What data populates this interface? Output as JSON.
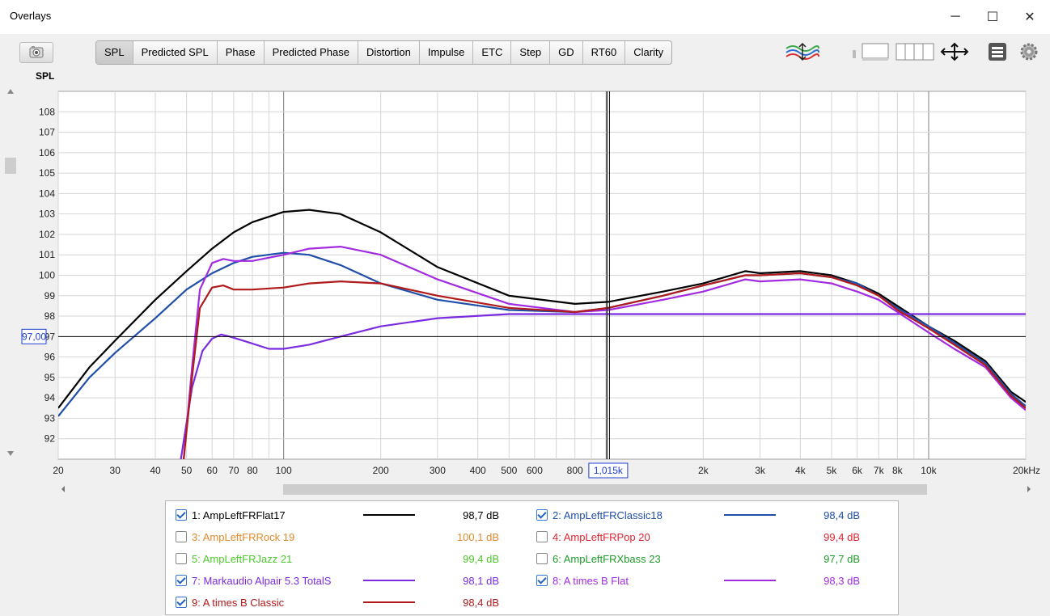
{
  "window": {
    "title": "Overlays"
  },
  "controls": {
    "minimize": "─",
    "maximize": "☐",
    "close": "✕"
  },
  "toolbar": {
    "tabs": [
      {
        "label": "SPL",
        "active": true
      },
      {
        "label": "Predicted SPL"
      },
      {
        "label": "Phase"
      },
      {
        "label": "Predicted Phase"
      },
      {
        "label": "Distortion"
      },
      {
        "label": "Impulse"
      },
      {
        "label": "ETC"
      },
      {
        "label": "Step"
      },
      {
        "label": "GD"
      },
      {
        "label": "RT60"
      },
      {
        "label": "Clarity"
      }
    ],
    "icons": [
      "camera-icon",
      "trace-arrange-icon",
      "panel-layout-icon",
      "column-layout-icon",
      "move-arrows-icon",
      "list-icon",
      "gear-icon"
    ]
  },
  "plot": {
    "y_axis_label": "SPL",
    "cursor_y_readout": "97,00",
    "cursor_x_readout": "1,015k"
  },
  "chart_data": {
    "type": "line",
    "x_scale": "log",
    "xlim": [
      20,
      20000
    ],
    "ylim": [
      91,
      109
    ],
    "y_ticks": [
      "92",
      "93",
      "94",
      "95",
      "96",
      "97",
      "98",
      "99",
      "100",
      "101",
      "102",
      "103",
      "104",
      "105",
      "106",
      "107",
      "108"
    ],
    "x_ticks": [
      "20",
      "30",
      "40",
      "50",
      "60",
      "70",
      "80",
      "100",
      "200",
      "300",
      "400",
      "500",
      "600",
      "800",
      "2k",
      "3k",
      "4k",
      "5k",
      "6k",
      "7k",
      "8k",
      "10k",
      "20kHz"
    ],
    "cursor": {
      "x": 1015,
      "y": 97.0
    },
    "grid": true,
    "series": [
      {
        "name": "1: AmpLeftFRFlat17",
        "color": "#000000",
        "x": [
          20,
          25,
          30,
          40,
          50,
          60,
          70,
          80,
          100,
          120,
          150,
          200,
          300,
          500,
          800,
          1015,
          1500,
          2000,
          2700,
          3000,
          4000,
          5000,
          6000,
          7000,
          8000,
          10000,
          12000,
          15000,
          18000,
          20000
        ],
        "y": [
          93.5,
          95.5,
          96.8,
          98.8,
          100.2,
          101.3,
          102.1,
          102.6,
          103.1,
          103.2,
          103.0,
          102.1,
          100.4,
          99.0,
          98.6,
          98.7,
          99.2,
          99.6,
          100.2,
          100.1,
          100.2,
          100.0,
          99.6,
          99.1,
          98.5,
          97.5,
          96.8,
          95.8,
          94.3,
          93.8
        ]
      },
      {
        "name": "2: AmpLeftFRClassic18",
        "color": "#1f4fa8",
        "x": [
          20,
          25,
          30,
          40,
          50,
          60,
          70,
          80,
          100,
          120,
          150,
          200,
          300,
          500,
          800,
          1015,
          1500,
          2000,
          2700,
          3000,
          4000,
          5000,
          6000,
          7000,
          8000,
          10000,
          12000,
          15000,
          18000,
          20000
        ],
        "y": [
          93.1,
          95.0,
          96.2,
          97.9,
          99.3,
          100.1,
          100.6,
          100.9,
          101.1,
          101.0,
          100.5,
          99.6,
          98.8,
          98.3,
          98.2,
          98.4,
          99.0,
          99.5,
          100.0,
          100.0,
          100.1,
          99.9,
          99.6,
          99.0,
          98.4,
          97.5,
          96.7,
          95.7,
          94.2,
          93.6
        ]
      },
      {
        "name": "3: AmpLeftFRRock 19",
        "color": "#e08a2c",
        "hidden": true,
        "value": "100,1 dB"
      },
      {
        "name": "4: AmpLeftFRPop 20",
        "color": "#e0242f",
        "hidden": true,
        "value": "99,4 dB"
      },
      {
        "name": "5: AmpLeftFRJazz 21",
        "color": "#4cc92b",
        "hidden": true,
        "value": "99,4 dB"
      },
      {
        "name": "6: AmpLeftFRXbass 23",
        "color": "#1e9b2a",
        "hidden": true,
        "value": "97,7 dB"
      },
      {
        "name": "7: Markaudio Alpair 5.3 TotalS",
        "color": "#7b2be0",
        "x": [
          48,
          52,
          56,
          60,
          64,
          68,
          75,
          90,
          100,
          120,
          150,
          200,
          300,
          500,
          800,
          1015,
          2000,
          5000,
          10000,
          20000
        ],
        "y": [
          91.0,
          94.5,
          96.3,
          96.9,
          97.1,
          97.0,
          96.8,
          96.4,
          96.4,
          96.6,
          97.0,
          97.5,
          97.9,
          98.1,
          98.1,
          98.1,
          98.1,
          98.1,
          98.1,
          98.1
        ]
      },
      {
        "name": "8: A times B Flat",
        "color": "#a22be0",
        "x": [
          49,
          52,
          55,
          60,
          65,
          70,
          80,
          100,
          120,
          150,
          200,
          300,
          500,
          800,
          1015,
          1500,
          2000,
          2700,
          3000,
          4000,
          5000,
          6000,
          7000,
          8000,
          10000,
          12000,
          15000,
          18000,
          20000
        ],
        "y": [
          91.0,
          95.5,
          99.3,
          100.6,
          100.8,
          100.7,
          100.7,
          101.0,
          101.3,
          101.4,
          101.0,
          99.8,
          98.6,
          98.2,
          98.3,
          98.8,
          99.2,
          99.8,
          99.7,
          99.8,
          99.6,
          99.2,
          98.8,
          98.2,
          97.2,
          96.4,
          95.5,
          94.0,
          93.4
        ]
      },
      {
        "name": "9: A times B Classic",
        "color": "#b01a1a",
        "x": [
          49,
          52,
          55,
          60,
          65,
          70,
          80,
          100,
          120,
          150,
          200,
          300,
          500,
          800,
          1015,
          1500,
          2000,
          2700,
          3000,
          4000,
          5000,
          6000,
          7000,
          8000,
          10000,
          12000,
          15000,
          18000,
          20000
        ],
        "y": [
          91.0,
          95.0,
          98.4,
          99.4,
          99.5,
          99.3,
          99.3,
          99.4,
          99.6,
          99.7,
          99.6,
          99.0,
          98.4,
          98.2,
          98.4,
          99.0,
          99.5,
          100.0,
          100.0,
          100.1,
          99.9,
          99.5,
          99.0,
          98.3,
          97.4,
          96.6,
          95.6,
          94.1,
          93.5
        ]
      }
    ]
  },
  "legend": {
    "items": [
      {
        "label": "1: AmpLeftFRFlat17",
        "value": "98,7 dB",
        "checked": true,
        "color": "#000000",
        "show_line": true
      },
      {
        "label": "2: AmpLeftFRClassic18",
        "value": "98,4 dB",
        "checked": true,
        "color": "#1f4fa8",
        "show_line": true
      },
      {
        "label": "3: AmpLeftFRRock 19",
        "value": "100,1 dB",
        "checked": false,
        "color": "#e08a2c",
        "show_line": false
      },
      {
        "label": "4: AmpLeftFRPop 20",
        "value": "99,4 dB",
        "checked": false,
        "color": "#e0242f",
        "show_line": false
      },
      {
        "label": "5: AmpLeftFRJazz 21",
        "value": "99,4 dB",
        "checked": false,
        "color": "#4cc92b",
        "show_line": false
      },
      {
        "label": "6: AmpLeftFRXbass 23",
        "value": "97,7 dB",
        "checked": false,
        "color": "#1e9b2a",
        "show_line": false
      },
      {
        "label": "7: Markaudio Alpair 5.3 TotalS",
        "value": "98,1 dB",
        "checked": true,
        "color": "#7b2be0",
        "show_line": true
      },
      {
        "label": "8: A times B Flat",
        "value": "98,3 dB",
        "checked": true,
        "color": "#a22be0",
        "show_line": true
      },
      {
        "label": "9: A times B Classic",
        "value": "98,4 dB",
        "checked": true,
        "color": "#b01a1a",
        "show_line": true
      }
    ]
  }
}
